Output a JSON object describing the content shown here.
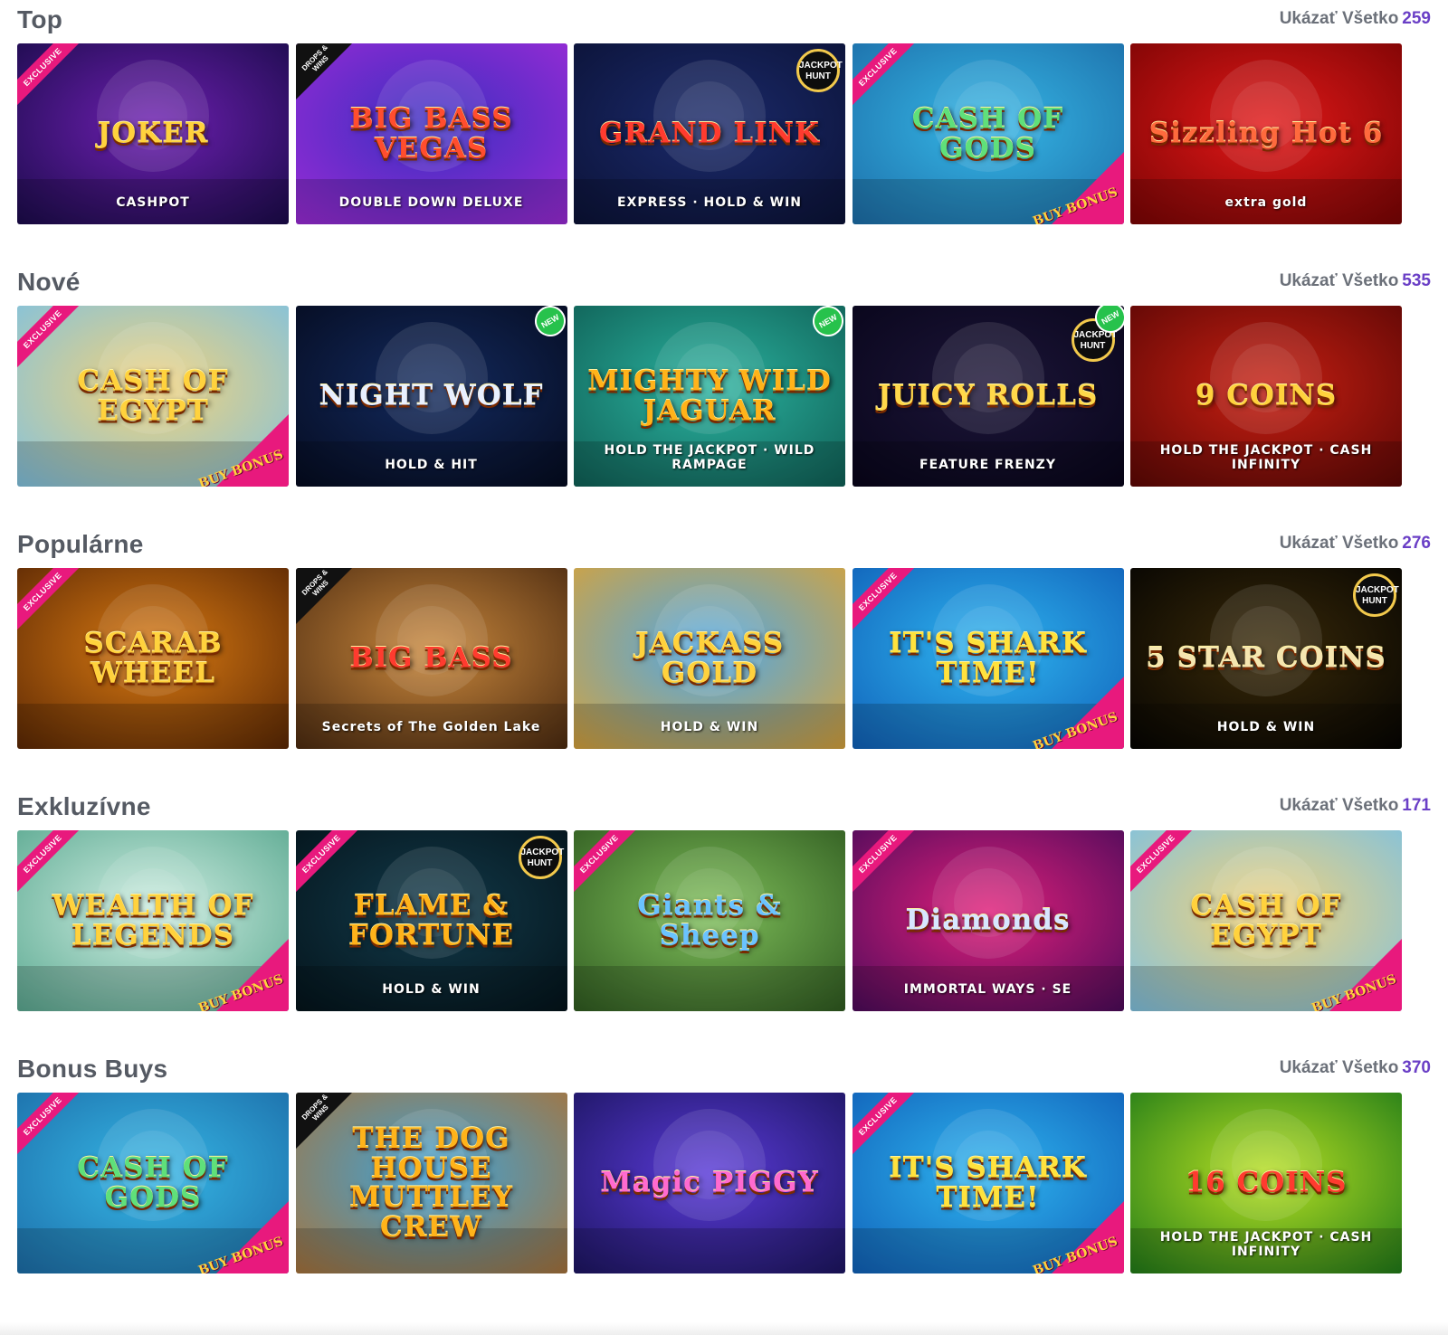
{
  "sections": [
    {
      "title": "Top",
      "show_all_label": "Ukázať Všetko",
      "count": "259",
      "games": [
        {
          "title": "JOKER",
          "subtitle": "CASHPOT",
          "ribbon": "EXCLUSIVE",
          "bg": [
            "#6d1fb0",
            "#1a0b4a"
          ],
          "title_color": "#ffd23d"
        },
        {
          "title": "BIG BASS VEGAS",
          "subtitle": "DOUBLE DOWN DELUXE",
          "drops": "DROPS & WINS",
          "bg": [
            "#3b2ec0",
            "#9b2bd6"
          ],
          "title_color": "#ff4d2e"
        },
        {
          "title": "GRAND LINK",
          "subtitle": "EXPRESS · HOLD & WIN",
          "jackpot": "JACKPOT HUNT",
          "bg": [
            "#1b2a6b",
            "#0b1236"
          ],
          "title_color": "#ff3b2f"
        },
        {
          "title": "CASH OF GODS",
          "subtitle": "",
          "ribbon": "EXCLUSIVE",
          "bonus": "BUY BONUS",
          "bg": [
            "#36b7e6",
            "#1c6da8"
          ],
          "title_color": "#5fe07a"
        },
        {
          "title": "Sizzling Hot 6",
          "subtitle": "extra gold",
          "bg": [
            "#e21818",
            "#7a0404"
          ],
          "title_color": "#ff6a3d"
        }
      ]
    },
    {
      "title": "Nové",
      "show_all_label": "Ukázať Všetko",
      "count": "535",
      "games": [
        {
          "title": "CASH OF EGYPT",
          "subtitle": "",
          "ribbon": "EXCLUSIVE",
          "bonus": "BUY BONUS",
          "bg": [
            "#f2d27a",
            "#7fc1e0"
          ],
          "title_color": "#ffd23d"
        },
        {
          "title": "NIGHT WOLF",
          "subtitle": "HOLD & HIT",
          "new": "NEW",
          "bg": [
            "#132a5e",
            "#050b1f"
          ],
          "title_color": "#e8f0ff"
        },
        {
          "title": "MIGHTY WILD JAGUAR",
          "subtitle": "HOLD THE JACKPOT · WILD RAMPAGE",
          "new": "NEW",
          "bg": [
            "#2bb3a0",
            "#0f5f55"
          ],
          "title_color": "#ffb31a"
        },
        {
          "title": "JUICY ROLLS",
          "subtitle": "FEATURE FRENZY",
          "new": "NEW",
          "jackpot": "JACKPOT HUNT",
          "bg": [
            "#1c1538",
            "#08051a"
          ],
          "title_color": "#ffd84a"
        },
        {
          "title": "9 COINS",
          "subtitle": "HOLD THE JACKPOT · CASH INFINITY",
          "bg": [
            "#c71f12",
            "#5c0705"
          ],
          "title_color": "#ffd23d"
        }
      ]
    },
    {
      "title": "Populárne",
      "show_all_label": "Ukázať Všetko",
      "count": "276",
      "games": [
        {
          "title": "SCARAB WHEEL",
          "subtitle": "",
          "ribbon": "EXCLUSIVE",
          "bg": [
            "#d97a12",
            "#5a2704"
          ],
          "title_color": "#ffd23d"
        },
        {
          "title": "BIG BASS",
          "subtitle": "Secrets of The Golden Lake",
          "drops": "DROPS & WINS",
          "bg": [
            "#c8873c",
            "#4b2a10"
          ],
          "title_color": "#ff3b2f"
        },
        {
          "title": "JACKASS GOLD",
          "subtitle": "HOLD & WIN",
          "bg": [
            "#4fa8e8",
            "#d6a23a"
          ],
          "title_color": "#ffd23d"
        },
        {
          "title": "IT'S SHARK TIME!",
          "subtitle": "",
          "ribbon": "EXCLUSIVE",
          "bonus": "BUY BONUS",
          "bg": [
            "#2fb5f0",
            "#1060b8"
          ],
          "title_color": "#ffe23d"
        },
        {
          "title": "5 STAR COINS",
          "subtitle": "HOLD & WIN",
          "jackpot": "JACKPOT HUNT",
          "bg": [
            "#3a2a08",
            "#050402"
          ],
          "title_color": "#f5e6b0"
        }
      ]
    },
    {
      "title": "Exkluzívne",
      "show_all_label": "Ukázať Všetko",
      "count": "171",
      "games": [
        {
          "title": "WEALTH OF LEGENDS",
          "subtitle": "",
          "ribbon": "EXCLUSIVE",
          "bonus": "BUY BONUS",
          "bg": [
            "#cfeee2",
            "#5aa890"
          ],
          "title_color": "#ffd23d"
        },
        {
          "title": "FLAME & FORTUNE",
          "subtitle": "HOLD & WIN",
          "ribbon": "EXCLUSIVE",
          "jackpot": "JACKPOT HUNT",
          "bg": [
            "#123a4a",
            "#04131a"
          ],
          "title_color": "#ffb31a"
        },
        {
          "title": "Giants & Sheep",
          "subtitle": "",
          "ribbon": "EXCLUSIVE",
          "bg": [
            "#7fbf5a",
            "#2f5a20"
          ],
          "title_color": "#6ac3ff"
        },
        {
          "title": "Diamonds",
          "subtitle": "IMMORTAL WAYS · SE",
          "ribbon": "EXCLUSIVE",
          "bg": [
            "#e01f7a",
            "#4b0b5a"
          ],
          "title_color": "#d7e6ff"
        },
        {
          "title": "CASH OF EGYPT",
          "subtitle": "",
          "ribbon": "EXCLUSIVE",
          "bonus": "BUY BONUS",
          "bg": [
            "#f2d27a",
            "#7fc1e0"
          ],
          "title_color": "#ffd23d"
        }
      ]
    },
    {
      "title": "Bonus Buys",
      "show_all_label": "Ukázať Všetko",
      "count": "370",
      "games": [
        {
          "title": "CASH OF GODS",
          "subtitle": "",
          "ribbon": "EXCLUSIVE",
          "bonus": "BUY BONUS",
          "bg": [
            "#36b7e6",
            "#1c6da8"
          ],
          "title_color": "#5fe07a"
        },
        {
          "title": "THE DOG HOUSE MUTTLEY CREW",
          "subtitle": "",
          "drops": "DROPS & WINS",
          "bg": [
            "#3ea3d8",
            "#a8733a"
          ],
          "title_color": "#ffb31a"
        },
        {
          "title": "Magic PIGGY",
          "subtitle": "",
          "bg": [
            "#5a3ad8",
            "#1c1560"
          ],
          "title_color": "#ff6ad0"
        },
        {
          "title": "IT'S SHARK TIME!",
          "subtitle": "",
          "ribbon": "EXCLUSIVE",
          "bonus": "BUY BONUS",
          "bg": [
            "#2fb5f0",
            "#1060b8"
          ],
          "title_color": "#ffe23d"
        },
        {
          "title": "16 COINS",
          "subtitle": "HOLD THE JACKPOT · CASH INFINITY",
          "bg": [
            "#b8e023",
            "#1f7a18"
          ],
          "title_color": "#ff3b2f"
        }
      ]
    }
  ]
}
